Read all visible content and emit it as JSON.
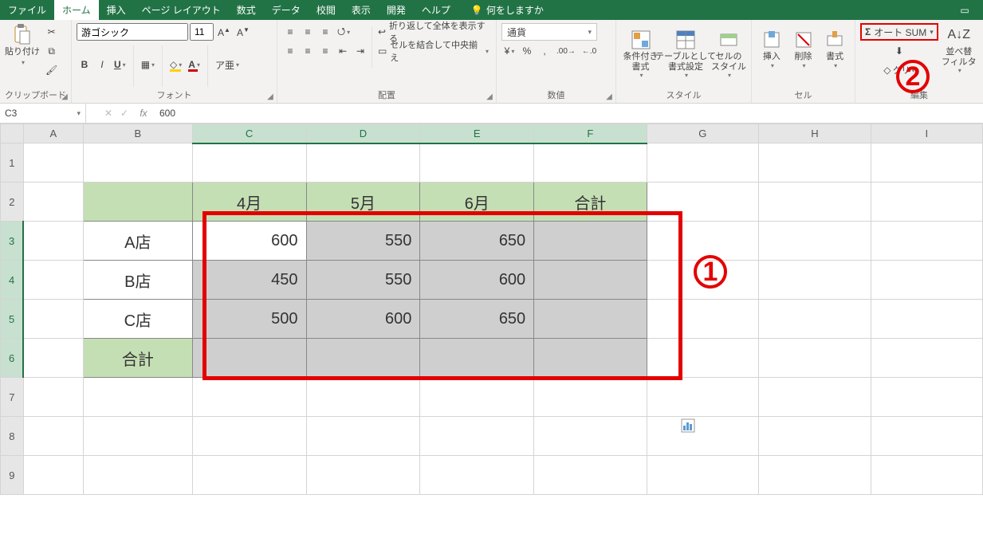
{
  "window": {
    "title": ""
  },
  "tabs": {
    "file": "ファイル",
    "home": "ホーム",
    "insert": "挿入",
    "pagelayout": "ページ レイアウト",
    "formulas": "数式",
    "data": "データ",
    "review": "校閲",
    "view": "表示",
    "developer": "開発",
    "help": "ヘルプ",
    "tellme": "何をしますか"
  },
  "ribbon": {
    "clipboard": {
      "paste": "貼り付け",
      "label": "クリップボード"
    },
    "font": {
      "name": "游ゴシック",
      "size": "11",
      "bold": "B",
      "italic": "I",
      "underline": "U",
      "label": "フォント"
    },
    "alignment": {
      "wrap": "折り返して全体を表示する",
      "merge": "セルを結合して中央揃え",
      "label": "配置"
    },
    "number": {
      "format": "通貨",
      "label": "数値"
    },
    "styles": {
      "cond": "条件付き\n書式",
      "table": "テーブルとして\n書式設定",
      "cell": "セルの\nスタイル",
      "label": "スタイル"
    },
    "cells": {
      "insert": "挿入",
      "delete": "削除",
      "format": "書式",
      "label": "セル"
    },
    "editing": {
      "autosum": "オート SUM",
      "clear": "クリ",
      "sort": "並べ替\nフィルタ",
      "label": "編集"
    }
  },
  "namebox": "C3",
  "formula": "600",
  "cols": [
    "A",
    "B",
    "C",
    "D",
    "E",
    "F",
    "G",
    "H",
    "I"
  ],
  "rows": [
    "1",
    "2",
    "3",
    "4",
    "5",
    "6",
    "7",
    "8",
    "9"
  ],
  "sheet": {
    "r2": {
      "C": "4月",
      "D": "5月",
      "E": "6月",
      "F": "合計"
    },
    "r3": {
      "B": "A店",
      "C": "600",
      "D": "550",
      "E": "650"
    },
    "r4": {
      "B": "B店",
      "C": "450",
      "D": "550",
      "E": "600"
    },
    "r5": {
      "B": "C店",
      "C": "500",
      "D": "600",
      "E": "650"
    },
    "r6": {
      "B": "合計"
    }
  },
  "callouts": {
    "one": "1",
    "two": "2"
  },
  "chart_data": {
    "type": "table",
    "title": "",
    "columns": [
      "4月",
      "5月",
      "6月",
      "合計"
    ],
    "rows": [
      "A店",
      "B店",
      "C店",
      "合計"
    ],
    "values": [
      [
        600,
        550,
        650,
        null
      ],
      [
        450,
        550,
        600,
        null
      ],
      [
        500,
        600,
        650,
        null
      ],
      [
        null,
        null,
        null,
        null
      ]
    ]
  }
}
